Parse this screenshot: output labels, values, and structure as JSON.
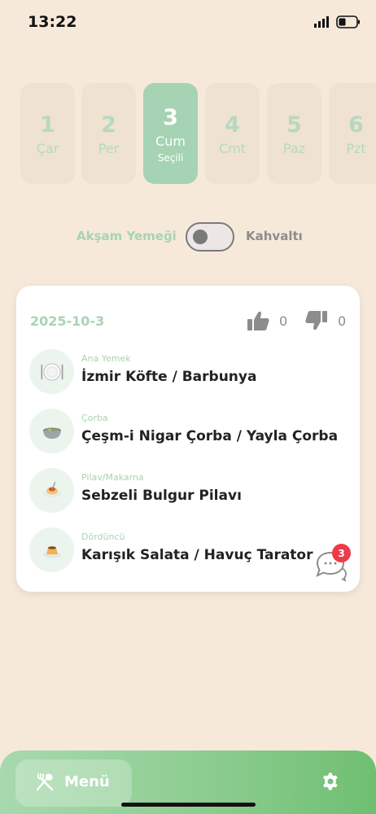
{
  "status": {
    "time": "13:22"
  },
  "days": [
    {
      "number": "1",
      "name": "Çar",
      "selected": false
    },
    {
      "number": "2",
      "name": "Per",
      "selected": false
    },
    {
      "number": "3",
      "name": "Cum",
      "selected": true,
      "selected_label": "Seçili"
    },
    {
      "number": "4",
      "name": "Cmt",
      "selected": false
    },
    {
      "number": "5",
      "name": "Paz",
      "selected": false
    },
    {
      "number": "6",
      "name": "Pzt",
      "selected": false
    }
  ],
  "meal_toggle": {
    "left_label": "Akşam Yemeği",
    "right_label": "Kahvaltı",
    "active": "left"
  },
  "menu_card": {
    "date": "2025-10-3",
    "likes": "0",
    "dislikes": "0",
    "courses": [
      {
        "category": "Ana Yemek",
        "dish": "İzmir Köfte / Barbunya",
        "icon": "plate-icon"
      },
      {
        "category": "Çorba",
        "dish": "Çeşm-i Nigar Çorba / Yayla Çorba",
        "icon": "soup-bowl-icon"
      },
      {
        "category": "Pilav/Makarna",
        "dish": "Sebzeli Bulgur Pilavı",
        "icon": "pasta-icon"
      },
      {
        "category": "Dördüncü",
        "dish": "Karışık Salata / Havuç Tarator",
        "icon": "dessert-icon"
      }
    ],
    "comment_count": "3"
  },
  "bottom_nav": {
    "menu_label": "Menü"
  },
  "colors": {
    "background": "#f6e9da",
    "accent_green": "#a5d3b3",
    "badge_red": "#f03a4a"
  }
}
